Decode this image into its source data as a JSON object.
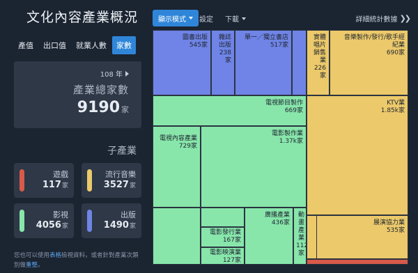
{
  "title": "文化內容產業概況",
  "metric_tabs": [
    "產值",
    "出口值",
    "就業人數",
    "家數"
  ],
  "active_tab": "家數",
  "summary": {
    "year": "108 年",
    "label": "產業總家數",
    "value": "9190",
    "unit": "家"
  },
  "sub_title": "子產業",
  "categories": [
    {
      "name": "遊戲",
      "value": "117",
      "unit": "家",
      "color": "#d85a4a"
    },
    {
      "name": "流行音樂",
      "value": "3527",
      "unit": "家",
      "color": "#ecc96a"
    },
    {
      "name": "影視",
      "value": "4056",
      "unit": "家",
      "color": "#88e6ab"
    },
    {
      "name": "出版",
      "value": "1490",
      "unit": "家",
      "color": "#6f84e6"
    }
  ],
  "footnote": {
    "pre": "您也可以使用",
    "link1": "表格",
    "mid": "檢視資料，或者針對產業次類別做",
    "link2": "重整",
    "post": "。"
  },
  "toolbar": {
    "mode_label": "顯示模式",
    "settings_label": "設定",
    "download_label": "下載",
    "detail_label": "詳細統計數據"
  },
  "icons": {
    "mode_caret": "caret-down-icon",
    "download_caret": "caret-down-icon",
    "detail": "double-chevron-right-icon",
    "year": "triangle-right-icon"
  },
  "treemap": {
    "cells": [
      {
        "label": "圖書出版",
        "value": "545家",
        "color": "blue"
      },
      {
        "label": "雜誌出版",
        "value": "238家",
        "color": "blue"
      },
      {
        "label": "單一／獨立書店",
        "value": "517家",
        "color": "blue"
      },
      {
        "label": "",
        "value": "",
        "color": "blue"
      },
      {
        "label": "實體唱片銷售業",
        "value": "226家",
        "color": "yellow"
      },
      {
        "label": "音樂製作/發行/歌手經紀業",
        "value": "690家",
        "color": "yellow"
      },
      {
        "label": "電視節目製作",
        "value": "669家",
        "color": "green"
      },
      {
        "label": "KTV業",
        "value": "1.85k家",
        "color": "yellow"
      },
      {
        "label": "電影製作業",
        "value": "1.37k家",
        "color": "green"
      },
      {
        "label": "電視內容產業",
        "value": "729家",
        "color": "green"
      },
      {
        "label": "廣播產業",
        "value": "436家",
        "color": "green"
      },
      {
        "label": "動畫產業",
        "value": "112家",
        "color": "green"
      },
      {
        "label": "電影發行業",
        "value": "167家",
        "color": "green"
      },
      {
        "label": "電影映演業",
        "value": "127家",
        "color": "green"
      },
      {
        "label": "展演協力業",
        "value": "535家",
        "color": "yellow"
      },
      {
        "label": "",
        "value": "",
        "color": "green"
      },
      {
        "label": "",
        "value": "",
        "color": "yellow"
      },
      {
        "label": "",
        "value": "",
        "color": "red"
      }
    ]
  }
}
